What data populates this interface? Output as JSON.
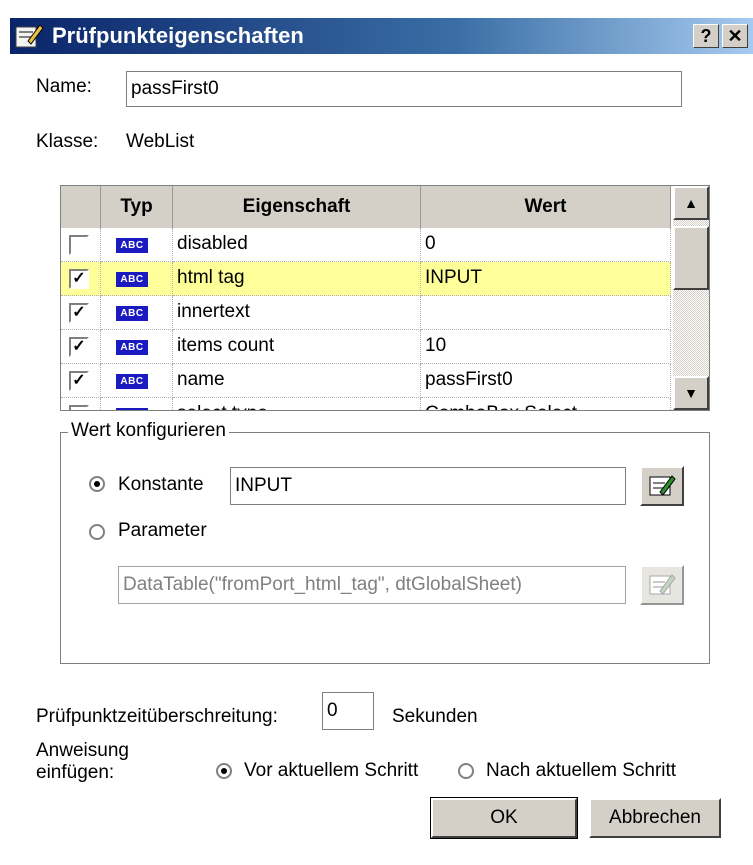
{
  "window": {
    "title": "Prüfpunkteigenschaften",
    "help_label": "?",
    "close_label": "✕"
  },
  "name_field": {
    "label": "Name:",
    "value": "passFirst0"
  },
  "class_field": {
    "label": "Klasse:",
    "value": "WebList"
  },
  "grid": {
    "columns": [
      "Typ",
      "Eigenschaft",
      "Wert"
    ],
    "type_badge": "ABC",
    "rows": [
      {
        "checked": false,
        "property": "disabled",
        "value": "0",
        "selected": false
      },
      {
        "checked": true,
        "property": "html tag",
        "value": "INPUT",
        "selected": true
      },
      {
        "checked": true,
        "property": "innertext",
        "value": "",
        "selected": false
      },
      {
        "checked": true,
        "property": "items count",
        "value": "10",
        "selected": false
      },
      {
        "checked": true,
        "property": "name",
        "value": "passFirst0",
        "selected": false
      },
      {
        "checked": false,
        "property": "select type",
        "value": "ComboBox Select",
        "selected": false
      }
    ],
    "scroll_up": "▲",
    "scroll_down": "▼"
  },
  "value_config": {
    "title": "Wert konfigurieren",
    "constant_label": "Konstante",
    "constant_value": "INPUT",
    "constant_selected": true,
    "parameter_label": "Parameter",
    "parameter_value": "DataTable(\"fromPort_html_tag\", dtGlobalSheet)",
    "parameter_selected": false
  },
  "timeout": {
    "label": "Prüfpunktzeitüberschreitung:",
    "value": "0",
    "unit": "Sekunden"
  },
  "insert": {
    "label_line1": "Anweisung",
    "label_line2": "einfügen:",
    "before_label": "Vor aktuellem Schritt",
    "after_label": "Nach aktuellem Schritt",
    "before_selected": true
  },
  "buttons": {
    "ok": "OK",
    "cancel": "Abbrechen"
  },
  "colors": {
    "titlebar": "#0a246a",
    "selected_row": "#ffff99",
    "badge": "#1a1ac0",
    "face": "#d4d0c8"
  }
}
